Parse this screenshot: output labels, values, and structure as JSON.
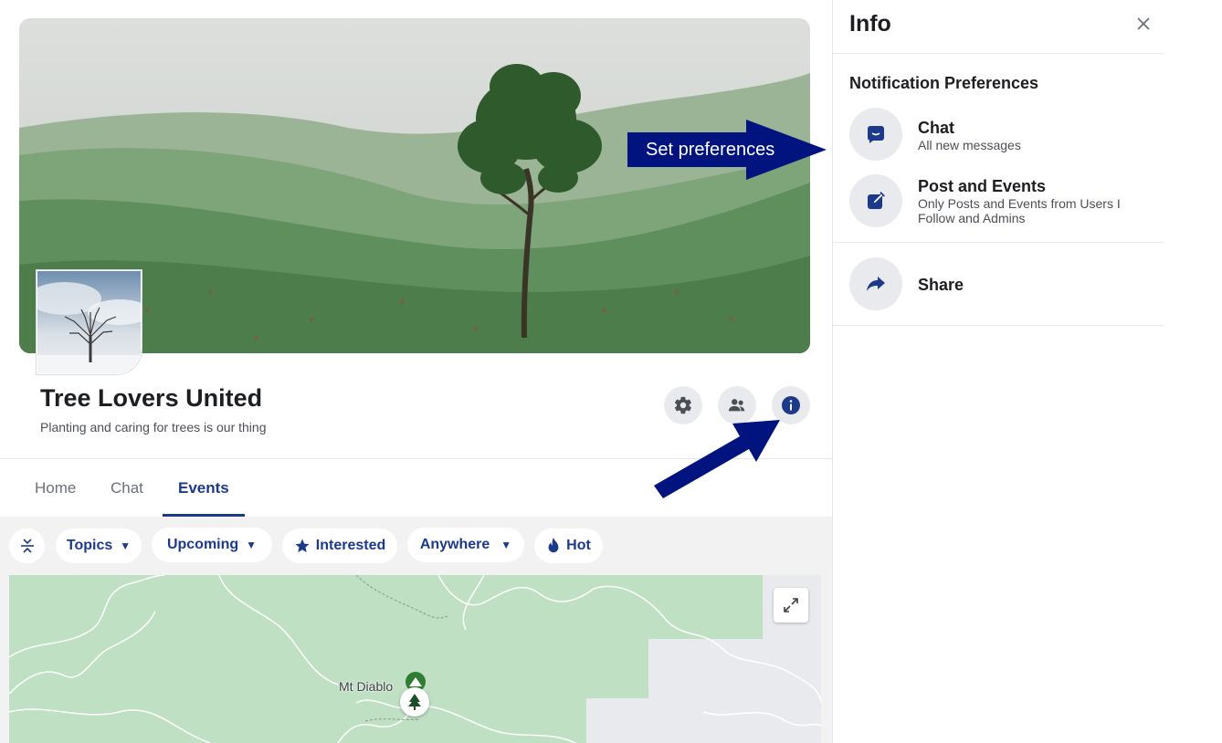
{
  "group": {
    "title": "Tree Lovers United",
    "subtitle": "Planting and caring for trees is our thing"
  },
  "tabs": [
    {
      "label": "Home",
      "active": false
    },
    {
      "label": "Chat",
      "active": false
    },
    {
      "label": "Events",
      "active": true
    }
  ],
  "header_actions": [
    {
      "icon": "gear-icon"
    },
    {
      "icon": "people-icon"
    },
    {
      "icon": "info-icon"
    }
  ],
  "filters": {
    "collapse_icon": "collapse-icon",
    "topics": "Topics",
    "upcoming": "Upcoming",
    "interested": "Interested",
    "anywhere": "Anywhere",
    "hot": "Hot"
  },
  "map": {
    "place_label": "Mt Diablo",
    "expand_icon": "expand-icon"
  },
  "annotations": {
    "preferences": "Set preferences",
    "info": "Info"
  },
  "panel": {
    "title": "Info",
    "notification_heading": "Notification Preferences",
    "items": [
      {
        "title": "Chat",
        "description": "All new messages",
        "icon": "chat-icon"
      },
      {
        "title": "Post and Events",
        "description": "Only Posts and Events from Users I Follow and Admins",
        "icon": "edit-icon"
      },
      {
        "title": "Share",
        "description": "",
        "icon": "share-icon"
      }
    ]
  },
  "colors": {
    "accent": "#1d3a8a",
    "annotation": "#00137f",
    "chip_bg": "#ffffff",
    "icon_bg": "#e9eaee",
    "map_green": "#bfe0c3"
  }
}
